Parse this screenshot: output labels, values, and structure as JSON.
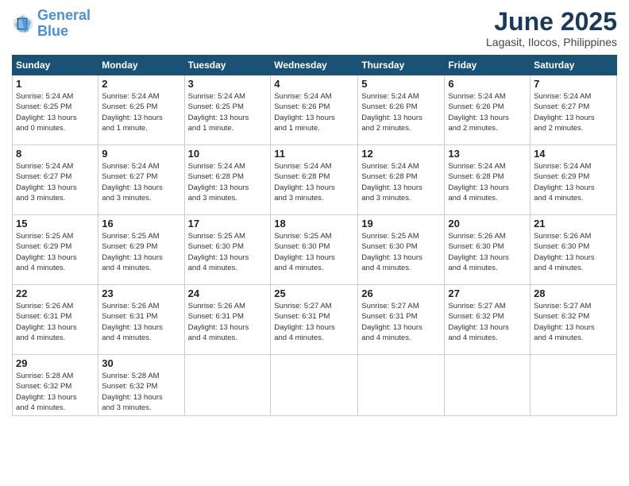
{
  "header": {
    "logo_line1": "General",
    "logo_line2": "Blue",
    "month": "June 2025",
    "location": "Lagasit, Ilocos, Philippines"
  },
  "weekdays": [
    "Sunday",
    "Monday",
    "Tuesday",
    "Wednesday",
    "Thursday",
    "Friday",
    "Saturday"
  ],
  "weeks": [
    [
      {
        "day": "1",
        "sunrise": "5:24 AM",
        "sunset": "6:25 PM",
        "daylight": "13 hours and 0 minutes."
      },
      {
        "day": "2",
        "sunrise": "5:24 AM",
        "sunset": "6:25 PM",
        "daylight": "13 hours and 1 minute."
      },
      {
        "day": "3",
        "sunrise": "5:24 AM",
        "sunset": "6:25 PM",
        "daylight": "13 hours and 1 minute."
      },
      {
        "day": "4",
        "sunrise": "5:24 AM",
        "sunset": "6:26 PM",
        "daylight": "13 hours and 1 minute."
      },
      {
        "day": "5",
        "sunrise": "5:24 AM",
        "sunset": "6:26 PM",
        "daylight": "13 hours and 2 minutes."
      },
      {
        "day": "6",
        "sunrise": "5:24 AM",
        "sunset": "6:26 PM",
        "daylight": "13 hours and 2 minutes."
      },
      {
        "day": "7",
        "sunrise": "5:24 AM",
        "sunset": "6:27 PM",
        "daylight": "13 hours and 2 minutes."
      }
    ],
    [
      {
        "day": "8",
        "sunrise": "5:24 AM",
        "sunset": "6:27 PM",
        "daylight": "13 hours and 3 minutes."
      },
      {
        "day": "9",
        "sunrise": "5:24 AM",
        "sunset": "6:27 PM",
        "daylight": "13 hours and 3 minutes."
      },
      {
        "day": "10",
        "sunrise": "5:24 AM",
        "sunset": "6:28 PM",
        "daylight": "13 hours and 3 minutes."
      },
      {
        "day": "11",
        "sunrise": "5:24 AM",
        "sunset": "6:28 PM",
        "daylight": "13 hours and 3 minutes."
      },
      {
        "day": "12",
        "sunrise": "5:24 AM",
        "sunset": "6:28 PM",
        "daylight": "13 hours and 3 minutes."
      },
      {
        "day": "13",
        "sunrise": "5:24 AM",
        "sunset": "6:28 PM",
        "daylight": "13 hours and 4 minutes."
      },
      {
        "day": "14",
        "sunrise": "5:24 AM",
        "sunset": "6:29 PM",
        "daylight": "13 hours and 4 minutes."
      }
    ],
    [
      {
        "day": "15",
        "sunrise": "5:25 AM",
        "sunset": "6:29 PM",
        "daylight": "13 hours and 4 minutes."
      },
      {
        "day": "16",
        "sunrise": "5:25 AM",
        "sunset": "6:29 PM",
        "daylight": "13 hours and 4 minutes."
      },
      {
        "day": "17",
        "sunrise": "5:25 AM",
        "sunset": "6:30 PM",
        "daylight": "13 hours and 4 minutes."
      },
      {
        "day": "18",
        "sunrise": "5:25 AM",
        "sunset": "6:30 PM",
        "daylight": "13 hours and 4 minutes."
      },
      {
        "day": "19",
        "sunrise": "5:25 AM",
        "sunset": "6:30 PM",
        "daylight": "13 hours and 4 minutes."
      },
      {
        "day": "20",
        "sunrise": "5:26 AM",
        "sunset": "6:30 PM",
        "daylight": "13 hours and 4 minutes."
      },
      {
        "day": "21",
        "sunrise": "5:26 AM",
        "sunset": "6:30 PM",
        "daylight": "13 hours and 4 minutes."
      }
    ],
    [
      {
        "day": "22",
        "sunrise": "5:26 AM",
        "sunset": "6:31 PM",
        "daylight": "13 hours and 4 minutes."
      },
      {
        "day": "23",
        "sunrise": "5:26 AM",
        "sunset": "6:31 PM",
        "daylight": "13 hours and 4 minutes."
      },
      {
        "day": "24",
        "sunrise": "5:26 AM",
        "sunset": "6:31 PM",
        "daylight": "13 hours and 4 minutes."
      },
      {
        "day": "25",
        "sunrise": "5:27 AM",
        "sunset": "6:31 PM",
        "daylight": "13 hours and 4 minutes."
      },
      {
        "day": "26",
        "sunrise": "5:27 AM",
        "sunset": "6:31 PM",
        "daylight": "13 hours and 4 minutes."
      },
      {
        "day": "27",
        "sunrise": "5:27 AM",
        "sunset": "6:32 PM",
        "daylight": "13 hours and 4 minutes."
      },
      {
        "day": "28",
        "sunrise": "5:27 AM",
        "sunset": "6:32 PM",
        "daylight": "13 hours and 4 minutes."
      }
    ],
    [
      {
        "day": "29",
        "sunrise": "5:28 AM",
        "sunset": "6:32 PM",
        "daylight": "13 hours and 4 minutes."
      },
      {
        "day": "30",
        "sunrise": "5:28 AM",
        "sunset": "6:32 PM",
        "daylight": "13 hours and 3 minutes."
      },
      null,
      null,
      null,
      null,
      null
    ]
  ]
}
